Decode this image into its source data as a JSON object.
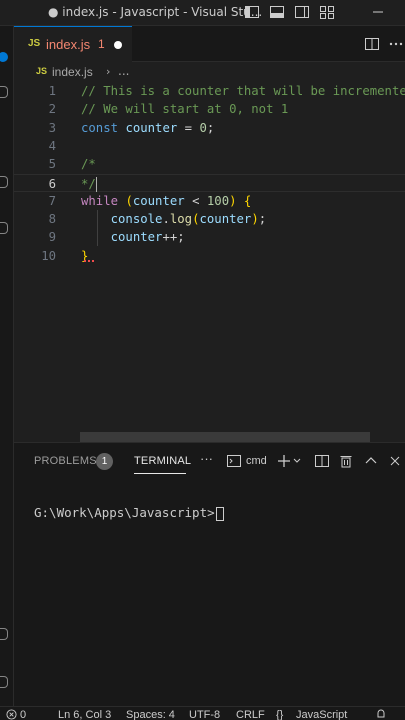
{
  "window": {
    "title": "● index.js - Javascript - Visual Stu..."
  },
  "tab": {
    "icon_label": "JS",
    "filename": "index.js",
    "problem_count": "1",
    "modified_indicator": "dot-icon"
  },
  "breadcrumb": {
    "icon_label": "JS",
    "file": "index.js",
    "separator": "›",
    "more": "..."
  },
  "editor": {
    "lines": [
      {
        "num": "1",
        "text": "// This is a counter that will be incremented"
      },
      {
        "num": "2",
        "text": "// We will start at 0, not 1"
      },
      {
        "num": "3",
        "text": "const counter = 0;"
      },
      {
        "num": "4",
        "text": ""
      },
      {
        "num": "5",
        "text": "/*"
      },
      {
        "num": "6",
        "text": "*/"
      },
      {
        "num": "7",
        "text": "while (counter < 100) {"
      },
      {
        "num": "8",
        "text": "    console.log(counter);"
      },
      {
        "num": "9",
        "text": "    counter++;"
      },
      {
        "num": "10",
        "text": "}"
      }
    ],
    "current_line": "6"
  },
  "panel": {
    "tabs": [
      {
        "label": "PROBLEMS",
        "badge": "1"
      },
      {
        "label": "TERMINAL"
      }
    ],
    "more": "···",
    "shell": "cmd",
    "terminal_prompt": "G:\\Work\\Apps\\Javascript>"
  },
  "statusbar": {
    "errors": "0",
    "position": "Ln 6, Col 3",
    "spaces": "Spaces: 4",
    "encoding": "UTF-8",
    "eol": "CRLF",
    "language": "JavaScript"
  },
  "colors": {
    "accent": "#0078d4",
    "comment": "#6a9955",
    "keyword": "#569cd6",
    "control": "#c586c0",
    "variable": "#9cdcfe",
    "function": "#dcdcaa",
    "number": "#b5cea8",
    "error": "#f48771",
    "js_icon": "#cbcb41"
  },
  "icons": [
    "layout-sidebar-left-icon",
    "layout-panel-icon",
    "layout-sidebar-right-icon",
    "layout-customize-icon",
    "minimize-icon",
    "split-editor-icon",
    "more-actions-icon",
    "terminal-icon",
    "add-terminal-icon",
    "chevron-down-icon",
    "split-terminal-icon",
    "trash-icon",
    "chevron-up-icon",
    "error-icon",
    "warning-icon",
    "bell-icon"
  ]
}
